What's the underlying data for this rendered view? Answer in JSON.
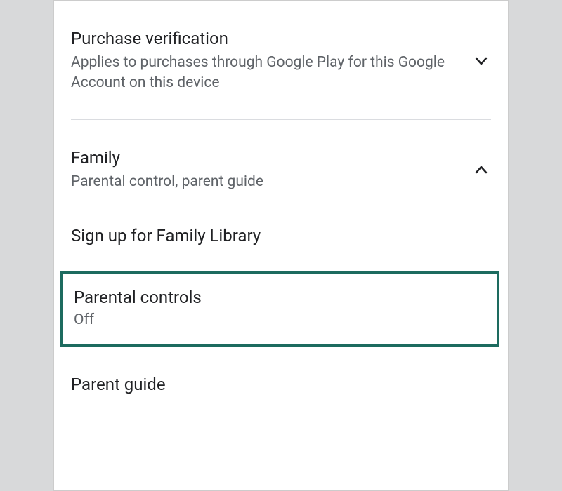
{
  "sections": {
    "purchase": {
      "title": "Purchase verification",
      "subtitle": "Applies to purchases through Google Play for this Google Account on this device"
    },
    "family": {
      "title": "Family",
      "subtitle": "Parental control, parent guide",
      "items": {
        "signup": {
          "title": "Sign up for Family Library"
        },
        "parental_controls": {
          "title": "Parental controls",
          "subtitle": "Off"
        },
        "parent_guide": {
          "title": "Parent guide"
        }
      }
    }
  }
}
